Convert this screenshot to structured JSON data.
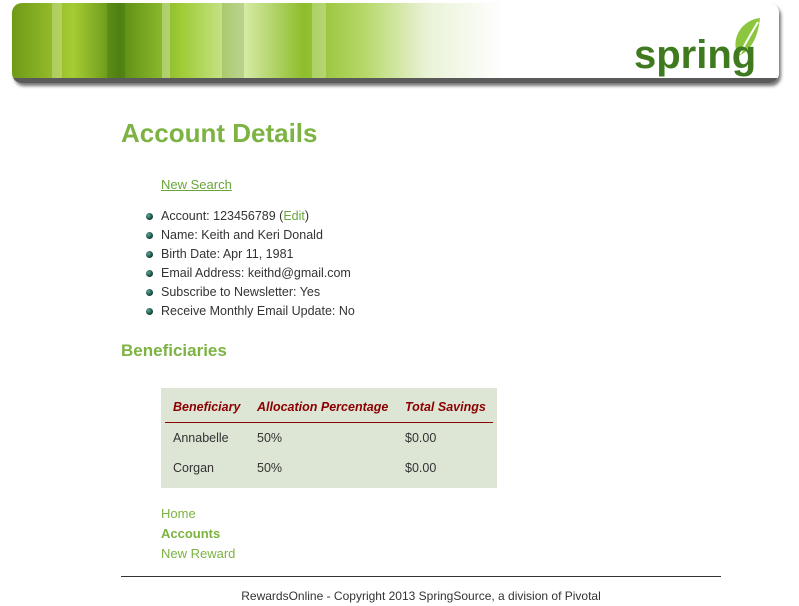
{
  "header": {
    "logo_text": "spring",
    "colors": {
      "brand_green": "#3f7a1e",
      "leaf_green": "#8cc63f"
    }
  },
  "page": {
    "title": "Account Details"
  },
  "new_search_label": "New Search",
  "details": {
    "account_prefix": "Account: 123456789 (",
    "edit_label": "Edit",
    "account_suffix": ")",
    "name": "Name: Keith and Keri Donald",
    "birth_date": "Birth Date: Apr 11, 1981",
    "email": "Email Address: keithd@gmail.com",
    "newsletter": "Subscribe to Newsletter: Yes",
    "monthly_update": "Receive Monthly Email Update: No"
  },
  "beneficiaries": {
    "heading": "Beneficiaries",
    "columns": [
      "Beneficiary",
      "Allocation Percentage",
      "Total Savings"
    ],
    "rows": [
      [
        "Annabelle",
        "50%",
        "$0.00"
      ],
      [
        "Corgan",
        "50%",
        "$0.00"
      ]
    ]
  },
  "nav": {
    "home": "Home",
    "accounts": "Accounts",
    "new_reward": "New Reward"
  },
  "footer": {
    "text": "RewardsOnline - Copyright 2013 SpringSource, a division of Pivotal"
  },
  "theme": {
    "heading_green": "#7cb342",
    "table_header_red": "#8b0000",
    "table_bg": "#dde5d4"
  }
}
